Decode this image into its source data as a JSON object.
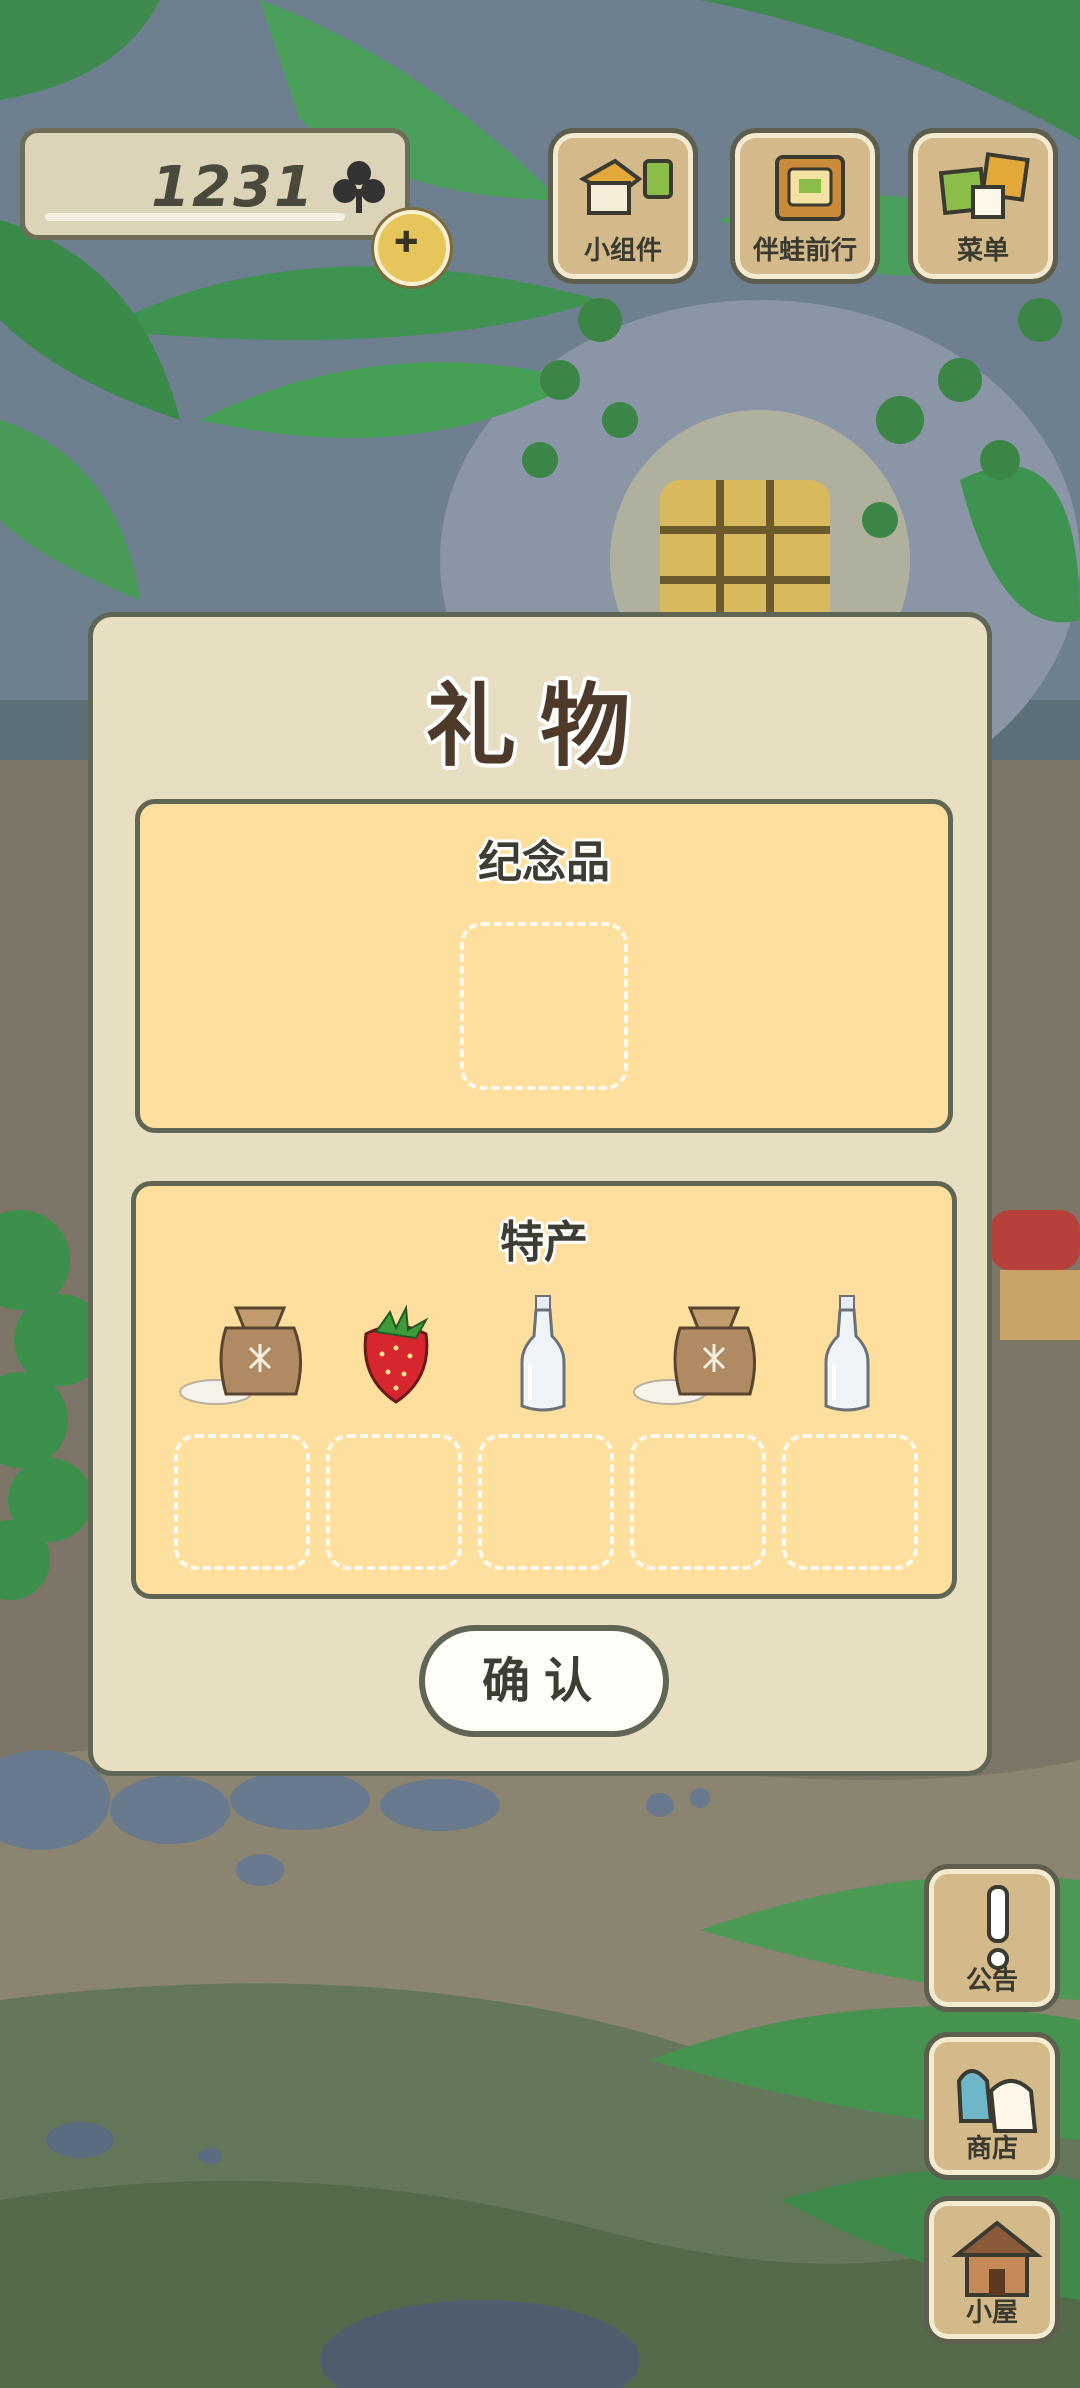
{
  "hud": {
    "clover_count": "1231",
    "top_buttons": [
      {
        "label": "小组件",
        "icon": "widget-icon"
      },
      {
        "label": "伴蛙前行",
        "icon": "journal-icon"
      },
      {
        "label": "菜单",
        "icon": "menu-cards-icon"
      }
    ],
    "side_buttons": [
      {
        "label": "公告",
        "icon": "exclamation-icon"
      },
      {
        "label": "商店",
        "icon": "shop-bags-icon"
      },
      {
        "label": "小屋",
        "icon": "house-icon"
      }
    ]
  },
  "dialog": {
    "title": "礼物",
    "souvenir_section": {
      "title": "纪念品",
      "slots": 1
    },
    "specialty_section": {
      "title": "特产",
      "items": [
        "rice-sack",
        "strawberry",
        "glass-bottle",
        "rice-sack",
        "glass-bottle"
      ],
      "slots": 5
    },
    "confirm_label": "确认"
  }
}
